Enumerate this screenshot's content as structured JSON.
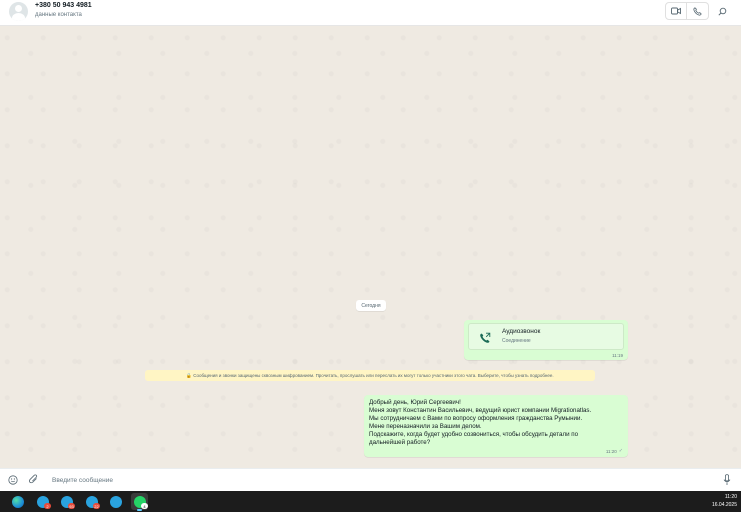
{
  "header": {
    "contact_name": "+380 50 943 4981",
    "contact_subtitle": "данные контакта",
    "actions": [
      "video-call-icon",
      "voice-call-icon",
      "search-icon"
    ]
  },
  "chat": {
    "date_label": "Сегодня",
    "call_message": {
      "title": "Аудиозвонок",
      "status": "Соединение",
      "time": "11:19"
    },
    "encryption_notice": "🔒 Сообщения и звонки защищены сквозным шифрованием. Прочитать, прослушать или переслать их могут только участники этого чата. Выберите, чтобы узнать подробнее.",
    "outgoing_message": {
      "lines": [
        "Добрый день, Юрий Сергеевич!",
        "Меня зовут Константин Васильевич, ведущий юрист компании Migrationatlas.",
        "Мы сотрудничаем с Вами по вопросу оформления гражданства Румынии.",
        "Мене переназначили за Вашим делом.",
        "Подскажите, когда будет удобно созвониться, чтобы обсудить детали по",
        "дальнейшей работе?"
      ],
      "time": "11:20",
      "status_icon": "single-check-icon"
    }
  },
  "composer": {
    "placeholder": "Введите сообщение",
    "value": ""
  },
  "taskbar": {
    "apps": [
      {
        "name": "edge",
        "color": "#1e8fd6",
        "badge": ""
      },
      {
        "name": "telegram-1",
        "color": "#2aa3df",
        "badge": "2"
      },
      {
        "name": "telegram-2",
        "color": "#2aa3df",
        "badge": "93"
      },
      {
        "name": "telegram-3",
        "color": "#2aa3df",
        "badge": "22"
      },
      {
        "name": "telegram-4",
        "color": "#2aa3df",
        "badge": ""
      },
      {
        "name": "whatsapp",
        "color": "#25d366",
        "badge": "4"
      }
    ],
    "time": "11:20",
    "date": "16.04.2025"
  },
  "colors": {
    "outgoing_bubble": "#d9fdd3",
    "chat_background": "#efeae2",
    "notice_background": "#fff5c4",
    "accent": "#25d366"
  }
}
